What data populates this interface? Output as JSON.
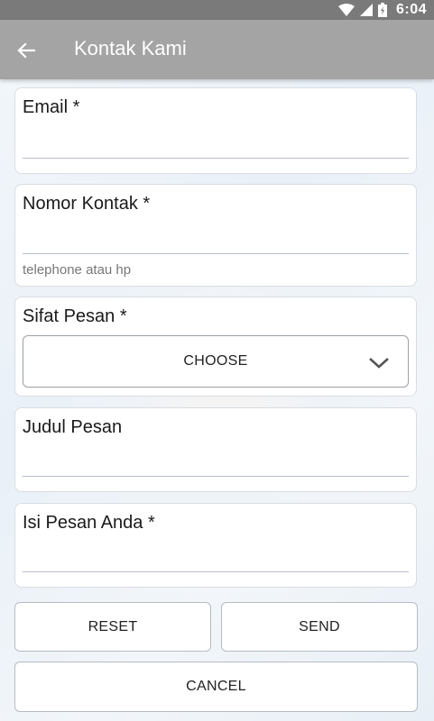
{
  "status_bar": {
    "time": "6:04"
  },
  "app_bar": {
    "title": "Kontak Kami",
    "back_icon": "arrow-left-icon"
  },
  "form": {
    "email": {
      "label": "Email *",
      "value": ""
    },
    "contact_number": {
      "label": "Nomor Kontak *",
      "value": "",
      "helper": "telephone atau hp"
    },
    "message_type": {
      "label": "Sifat Pesan *",
      "selected": "CHOOSE",
      "icon": "chevron-down-icon"
    },
    "message_title": {
      "label": "Judul Pesan",
      "value": ""
    },
    "message_body": {
      "label": "Isi Pesan Anda *",
      "value": ""
    }
  },
  "buttons": {
    "reset": "RESET",
    "send": "SEND",
    "cancel": "CANCEL"
  },
  "colors": {
    "status_bar": "#7a7a7a",
    "app_bar": "#a4a4a4",
    "card_background": "#ffffff"
  }
}
